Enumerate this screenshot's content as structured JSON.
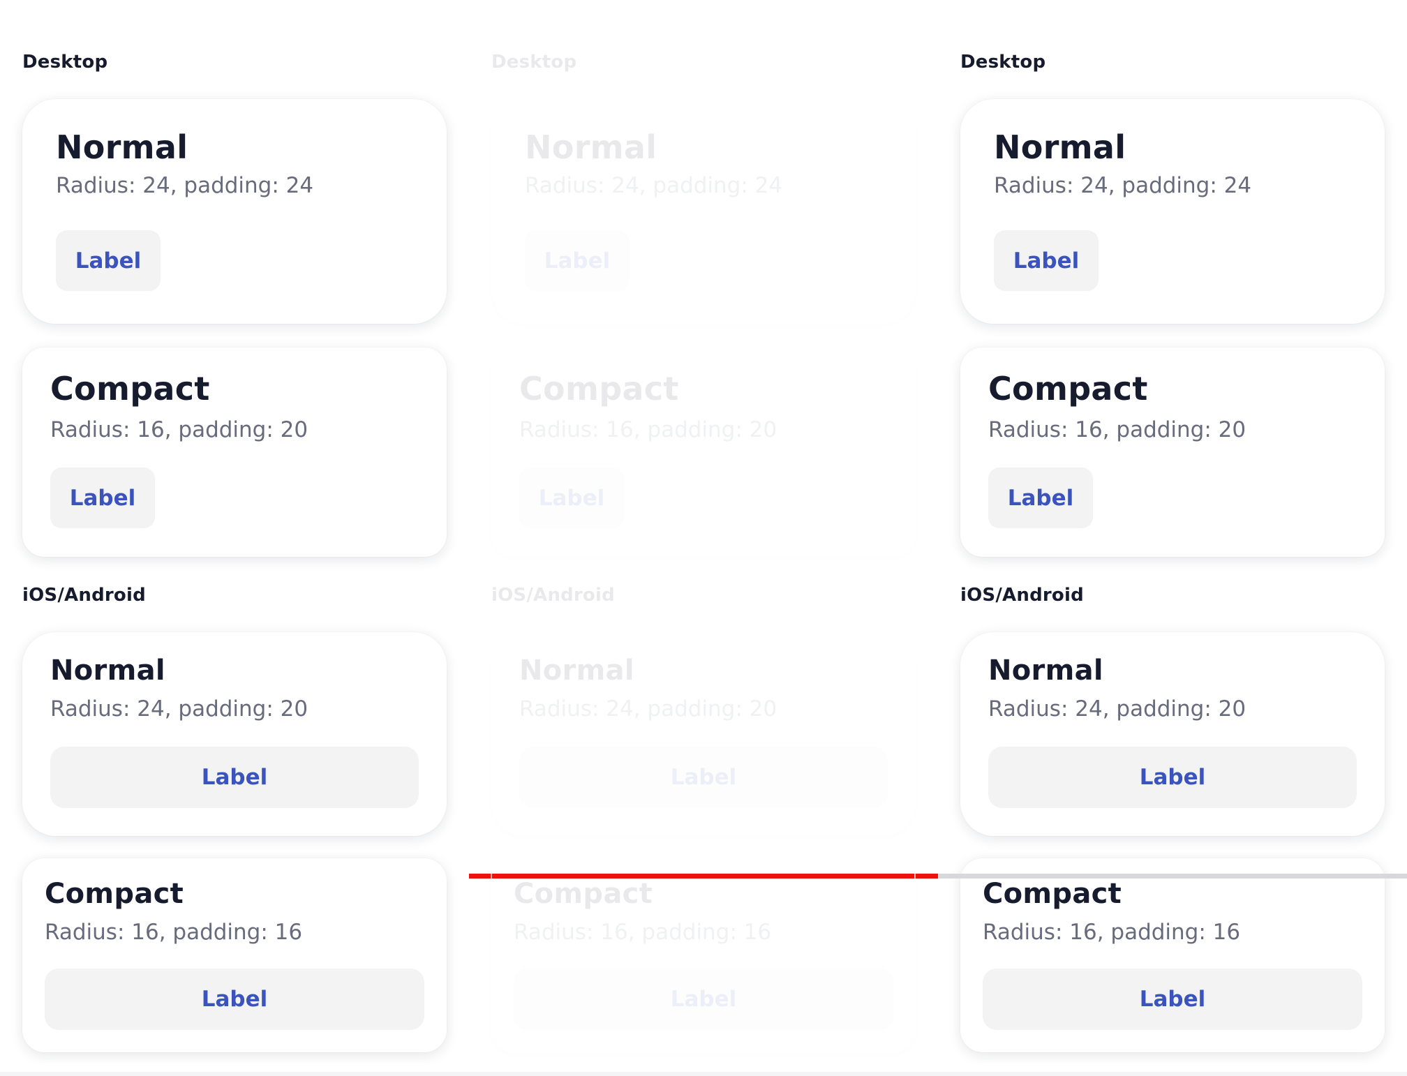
{
  "sections": {
    "desktop": "Desktop",
    "mobile": "iOS/Android"
  },
  "cards": {
    "desktop_normal": {
      "title": "Normal",
      "subtitle": "Radius: 24, padding: 24",
      "button": "Label"
    },
    "desktop_compact": {
      "title": "Compact",
      "subtitle": "Radius: 16, padding: 20",
      "button": "Label"
    },
    "mobile_normal": {
      "title": "Normal",
      "subtitle": "Radius: 24, padding: 20",
      "button": "Label"
    },
    "mobile_compact": {
      "title": "Compact",
      "subtitle": "Radius: 16, padding: 16",
      "button": "Label"
    }
  },
  "columns": [
    {
      "state": "default"
    },
    {
      "state": "faded"
    },
    {
      "state": "default"
    }
  ],
  "colors": {
    "title": "#171b2e",
    "subtitle": "#676b7b",
    "button_text": "#3b53bd",
    "button_bg": "#f3f3f4",
    "divider_active": "#ee1111",
    "divider_inactive": "#d8d8dc"
  }
}
